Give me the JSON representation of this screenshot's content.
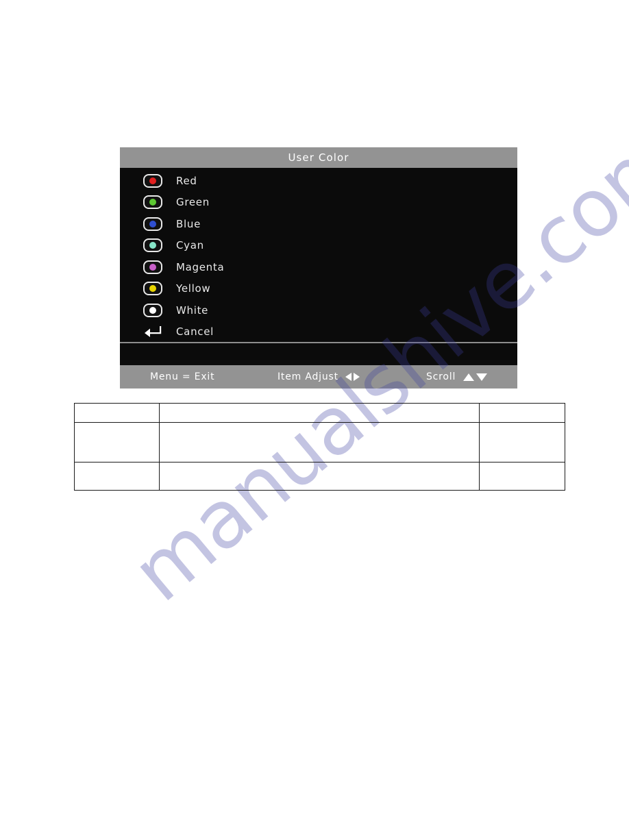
{
  "page": {
    "background_color": "#ffffff",
    "watermark_text": "manualshive.com",
    "watermark_color": "#3d3fa0"
  },
  "osd": {
    "header": {
      "title": "User Color",
      "bar_color": "#939393",
      "text_color": "#ffffff"
    },
    "background_color": "#0c0c0c",
    "items": [
      {
        "label": "Red",
        "icon": "color-swatch-icon",
        "dot_color": "#e01f1f"
      },
      {
        "label": "Green",
        "icon": "color-swatch-icon",
        "dot_color": "#5cc832"
      },
      {
        "label": "Blue",
        "icon": "color-swatch-icon",
        "dot_color": "#2f4fd0"
      },
      {
        "label": "Cyan",
        "icon": "color-swatch-icon",
        "dot_color": "#86e6c8"
      },
      {
        "label": "Magenta",
        "icon": "color-swatch-icon",
        "dot_color": "#c860c8"
      },
      {
        "label": "Yellow",
        "icon": "color-swatch-icon",
        "dot_color": "#e8d400"
      },
      {
        "label": "White",
        "icon": "color-swatch-icon",
        "dot_color": "#ffffff"
      },
      {
        "label": "Cancel",
        "icon": "return-arrow-icon",
        "dot_color": null
      }
    ],
    "footer": {
      "bar_color": "#939393",
      "exit_label": "Menu = Exit",
      "adjust_label": "Item Adjust",
      "scroll_label": "Scroll",
      "adjust_icons": [
        "triangle-left-icon",
        "triangle-right-icon"
      ],
      "scroll_icons": [
        "triangle-up-icon",
        "triangle-down-icon"
      ]
    }
  },
  "table": {
    "border_color": "#1a1a1a",
    "rows": [
      {
        "cells": [
          "",
          "",
          ""
        ]
      },
      {
        "cells": [
          "",
          "",
          ""
        ]
      },
      {
        "cells": [
          "",
          "",
          ""
        ]
      }
    ]
  }
}
